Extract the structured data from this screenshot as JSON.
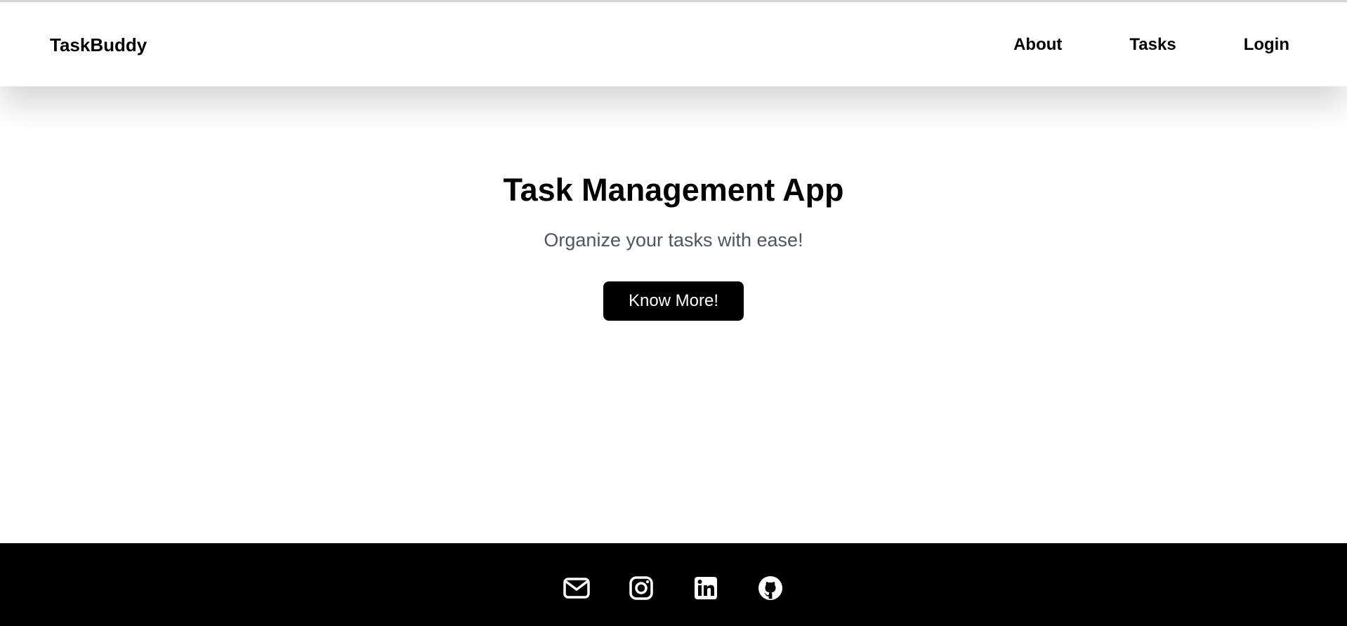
{
  "navbar": {
    "brand": "TaskBuddy",
    "links": [
      {
        "label": "About"
      },
      {
        "label": "Tasks"
      },
      {
        "label": "Login"
      }
    ]
  },
  "hero": {
    "title": "Task Management App",
    "subtitle": "Organize your tasks with ease!",
    "button_label": "Know More!"
  },
  "footer": {
    "icons": [
      "envelope-icon",
      "instagram-icon",
      "linkedin-icon",
      "github-icon"
    ]
  },
  "colors": {
    "primary": "#000000",
    "subtitle": "#4b5563",
    "background": "#ffffff",
    "footer_bg": "#000000",
    "footer_icon": "#ffffff"
  }
}
